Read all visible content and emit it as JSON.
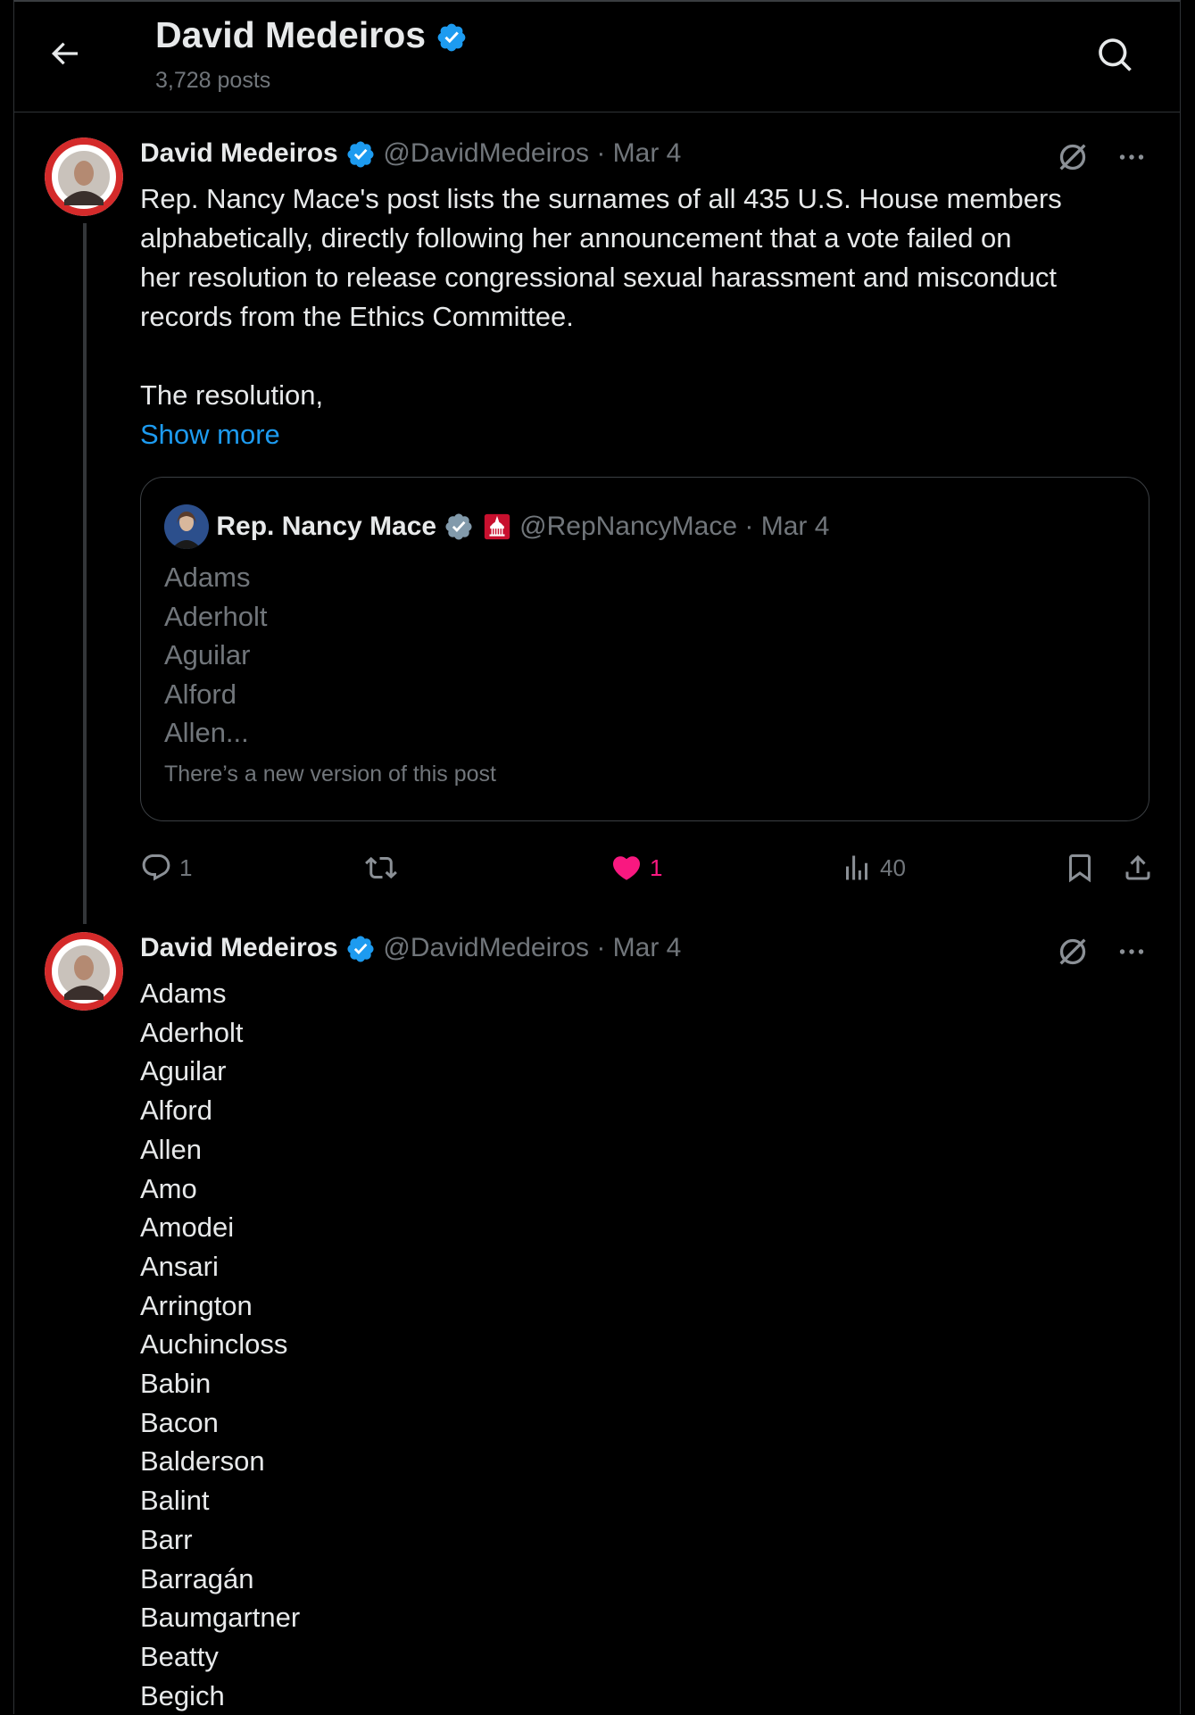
{
  "header": {
    "title": "David Medeiros",
    "posts_count": "3,728 posts"
  },
  "post1": {
    "author_name": "David Medeiros",
    "handle": "@DavidMedeiros",
    "date": "· Mar 4",
    "text_lines": [
      "Rep. Nancy Mace's post lists the surnames of all 435 U.S. House members",
      "alphabetically, directly following her announcement that a vote failed on",
      "her resolution to release congressional sexual harassment and misconduct",
      "records from the Ethics Committee.",
      "",
      "The resolution,"
    ],
    "show_more": "Show more",
    "quote": {
      "author_name": "Rep. Nancy Mace",
      "handle": "@RepNancyMace",
      "date": "· Mar 4",
      "lines": [
        "Adams",
        "Aderholt",
        "Aguilar",
        "Alford",
        "Allen..."
      ],
      "note": "There’s a new version of this post"
    },
    "actions": {
      "replies": "1",
      "reposts": "",
      "likes": "1",
      "views": "40"
    }
  },
  "post2": {
    "author_name": "David Medeiros",
    "handle": "@DavidMedeiros",
    "date": "· Mar 4",
    "lines": [
      "Adams",
      "Aderholt",
      "Aguilar",
      "Alford",
      "Allen",
      "Amo",
      "Amodei",
      "Ansari",
      "Arrington",
      "Auchincloss",
      "Babin",
      "Bacon",
      "Balderson",
      "Balint",
      "Barr",
      "Barragán",
      "Baumgartner",
      "Beatty",
      "Begich"
    ]
  },
  "colors": {
    "background": "#000000",
    "text": "#e7e9ea",
    "secondary": "#71767b",
    "accent": "#1d9bf0",
    "like": "#f91880"
  },
  "icons": [
    "back-arrow-icon",
    "search-icon",
    "verified-badge-icon",
    "grok-icon",
    "more-icon",
    "reply-icon",
    "repost-icon",
    "heart-icon",
    "views-icon",
    "bookmark-icon",
    "share-icon",
    "capitol-icon"
  ]
}
